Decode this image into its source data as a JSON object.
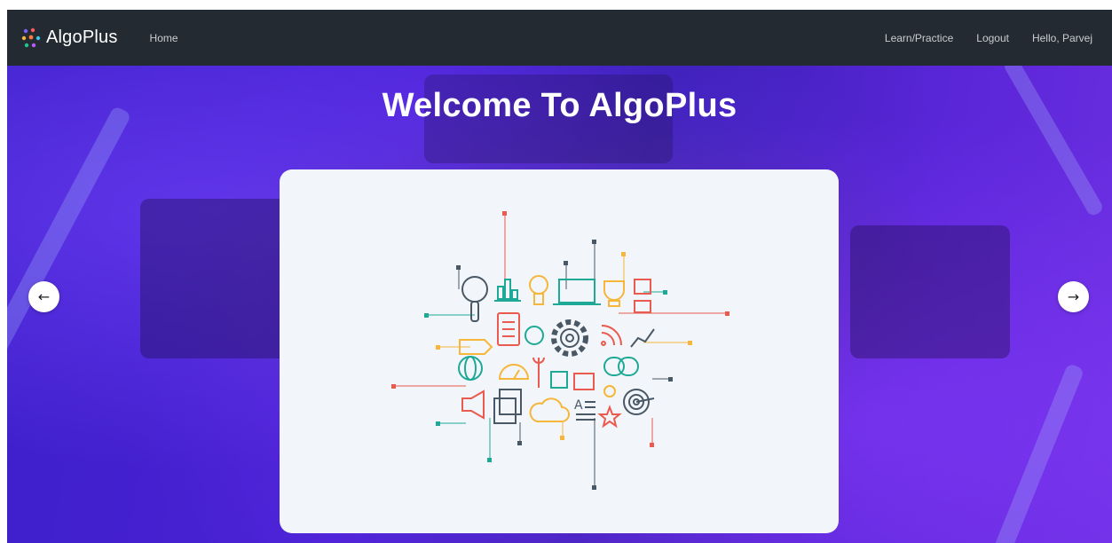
{
  "navbar": {
    "brand": "AlgoPlus",
    "home": "Home",
    "learn": "Learn/Practice",
    "logout": "Logout",
    "greeting": "Hello, Parvej"
  },
  "hero": {
    "title": "Welcome To AlgoPlus"
  },
  "carousel": {
    "prev_icon": "arrow-left-icon",
    "next_icon": "arrow-right-icon",
    "prev_glyph": "←",
    "next_glyph": "→"
  },
  "colors": {
    "navbar_bg": "#232a31",
    "hero_bg": "#4b22d6",
    "card_bg": "#f2f6fa",
    "icon_slate": "#4a5866",
    "icon_red": "#ea5a4f",
    "icon_yellow": "#f5b63a",
    "icon_teal": "#1ea896"
  }
}
